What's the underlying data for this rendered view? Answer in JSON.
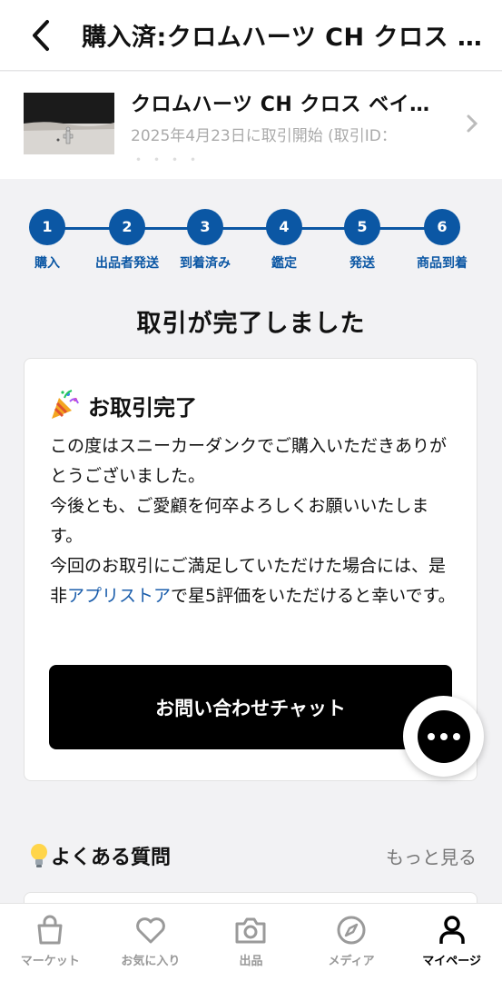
{
  "header": {
    "title": "購入済:クロムハーツ CH クロス ベイビーファット チャーム"
  },
  "product": {
    "name": "クロムハーツ CH クロス ベイビーファット チャーム",
    "meta": "2025年4月23日に取引開始 (取引ID：",
    "meta_hidden": "・・・・"
  },
  "steps": [
    {
      "number": "1",
      "label": "購入"
    },
    {
      "number": "2",
      "label": "出品者発送"
    },
    {
      "number": "3",
      "label": "到着済み"
    },
    {
      "number": "4",
      "label": "鑑定"
    },
    {
      "number": "5",
      "label": "発送"
    },
    {
      "number": "6",
      "label": "商品到着"
    }
  ],
  "status_heading": "取引が完了しました",
  "card": {
    "title": "お取引完了",
    "line1": "この度はスニーカーダンクでご購入いただきありがとうございました。",
    "line2": "今後とも、ご愛顧を何卒よろしくお願いいたします。",
    "line3_pre": "今回のお取引にご満足していただけた場合には、是非",
    "line3_link": "アプリストア",
    "line3_post": "で星5評価をいただけると幸いです。",
    "chat_button": "お問い合わせチャット"
  },
  "faq": {
    "title": "よくある質問",
    "more": "もっと見る"
  },
  "tabbar": [
    {
      "label": "マーケット",
      "icon": "bag-icon"
    },
    {
      "label": "お気に入り",
      "icon": "heart-icon"
    },
    {
      "label": "出品",
      "icon": "camera-icon"
    },
    {
      "label": "メディア",
      "icon": "compass-icon"
    },
    {
      "label": "マイページ",
      "icon": "person-icon",
      "active": true
    }
  ],
  "colors": {
    "accent": "#0b57a4",
    "link": "#1a5dab",
    "button": "#000000"
  }
}
